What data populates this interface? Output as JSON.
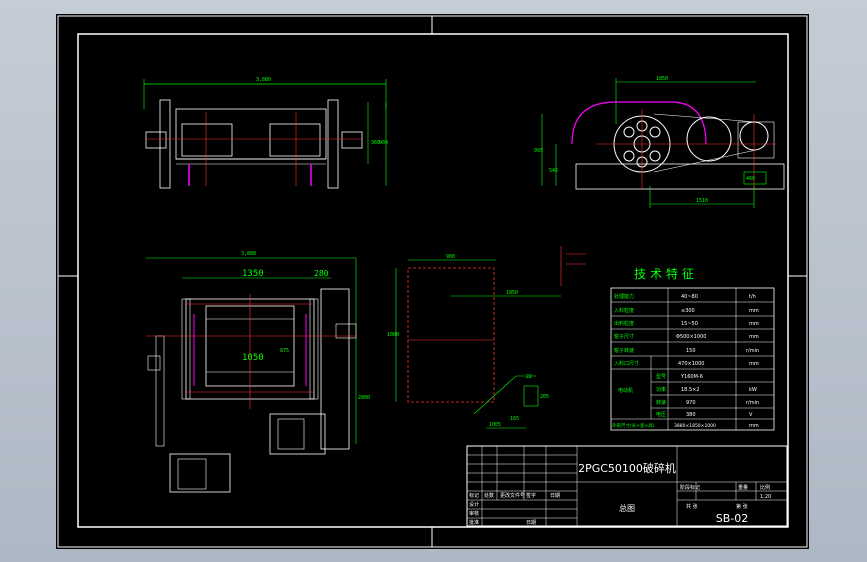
{
  "drawing": {
    "title": "2PGC50100破碎机",
    "view_name": "总图",
    "drawing_no": "SB-02",
    "scale": "1:20"
  },
  "dimensions": {
    "top_left_width": "3,880",
    "top_left_right_a": "360",
    "top_left_right_b": "900",
    "top_right_top": "1850",
    "top_right_left_a": "995",
    "top_right_left_b": "546",
    "top_right_bottom": "1510",
    "top_right_small": "460",
    "bottom_left_overall": "3,880",
    "bottom_left_main": "1350",
    "bottom_left_right": "280",
    "bottom_left_inner": "1050",
    "bottom_left_inner_v": "875",
    "bottom_left_height": "2800",
    "middle_top": "900",
    "middle_offset": "1850",
    "middle_height": "1000",
    "middle_small_a": "22",
    "middle_small_b": "205",
    "middle_small_c": "1005",
    "middle_small_d": "165"
  },
  "tech_table": {
    "heading": "技术特征",
    "rows": [
      {
        "name": "处理能力",
        "value": "40~80",
        "unit": "t/h"
      },
      {
        "name": "入料粒度",
        "value": "≤300",
        "unit": "mm"
      },
      {
        "name": "出料粒度",
        "value": "15~50",
        "unit": "mm"
      },
      {
        "name": "辊子尺寸",
        "value": "Φ500×1000",
        "unit": "mm"
      },
      {
        "name": "辊子转速",
        "value": "150",
        "unit": "r/min"
      },
      {
        "name": "入料口尺寸",
        "value": "470×1000",
        "unit": "mm"
      }
    ],
    "motor_group": "电动机",
    "motor_rows": [
      {
        "name": "型号",
        "value": "Y160M-6",
        "unit": ""
      },
      {
        "name": "功率",
        "value": "18.5×2",
        "unit": "kW"
      },
      {
        "name": "转速",
        "value": "970",
        "unit": "r/min"
      },
      {
        "name": "电压",
        "value": "380",
        "unit": "V"
      }
    ],
    "last_row": {
      "name": "外形尺寸(长×宽×高)",
      "value": "3880×1850×1000",
      "unit": "mm"
    }
  },
  "title_block": {
    "col_a": "标记",
    "col_b": "处数",
    "col_c": "更改文件号",
    "col_d": "签字",
    "col_e": "日期",
    "row_design": "设计",
    "row_check": "审核",
    "row_approve": "批准",
    "date_label": "日期",
    "stage_label": "阶段标记",
    "weight_label": "重量",
    "scale_label": "比例",
    "sheet_label": "共 张",
    "sheet_of": "第 张"
  },
  "colors": {
    "sheet_bg": "#000000",
    "line_white": "#ffffff",
    "line_green": "#00ff00",
    "line_red": "#ff3030",
    "line_magenta": "#ff00ff",
    "text_green": "#00ff00",
    "text_yellow": "#ffff00",
    "table_green": "#00e000"
  }
}
